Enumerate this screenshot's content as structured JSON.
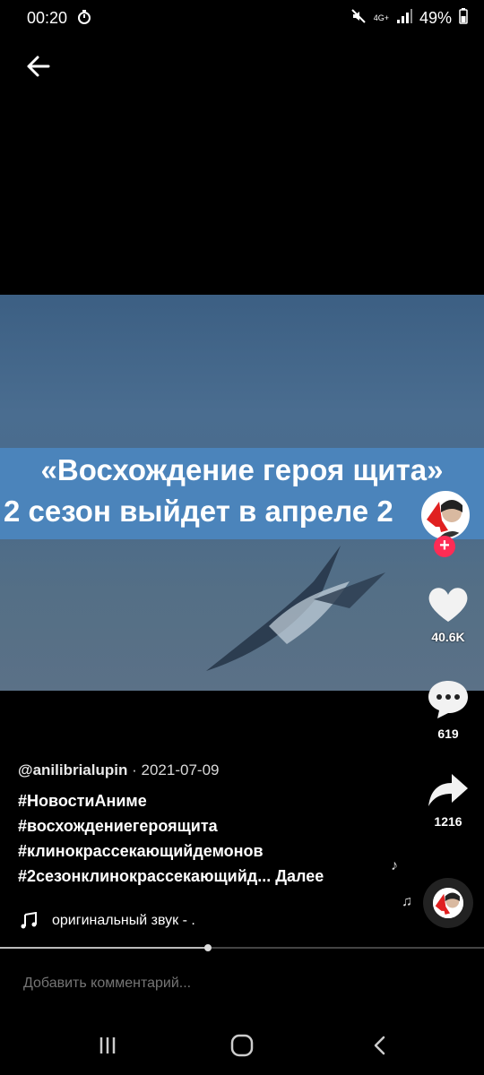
{
  "status": {
    "time": "00:20",
    "network": "4G+",
    "battery": "49%"
  },
  "video": {
    "banner_line1": "«Восхождение героя щита»",
    "banner_line2": "2 сезон выйдет в апреле 2"
  },
  "actions": {
    "likes": "40.6K",
    "comments": "619",
    "shares": "1216"
  },
  "caption": {
    "handle": "@anilibrialupin",
    "separator": "·",
    "date": "2021-07-09",
    "tags": [
      "#НовостиАниме",
      "#восхождениегероящита",
      "#клинокрассекающийдемонов",
      "#2сезонклинокрассекающийд..."
    ],
    "more": "Далее"
  },
  "sound": {
    "text": "оригинальный звук - ."
  },
  "progress": {
    "fraction": 0.43
  },
  "comment": {
    "placeholder": "Добавить комментарий..."
  },
  "colors": {
    "accent": "#fe2c55",
    "banner": "#4b84bb",
    "video_bg": "#4a6d90"
  }
}
